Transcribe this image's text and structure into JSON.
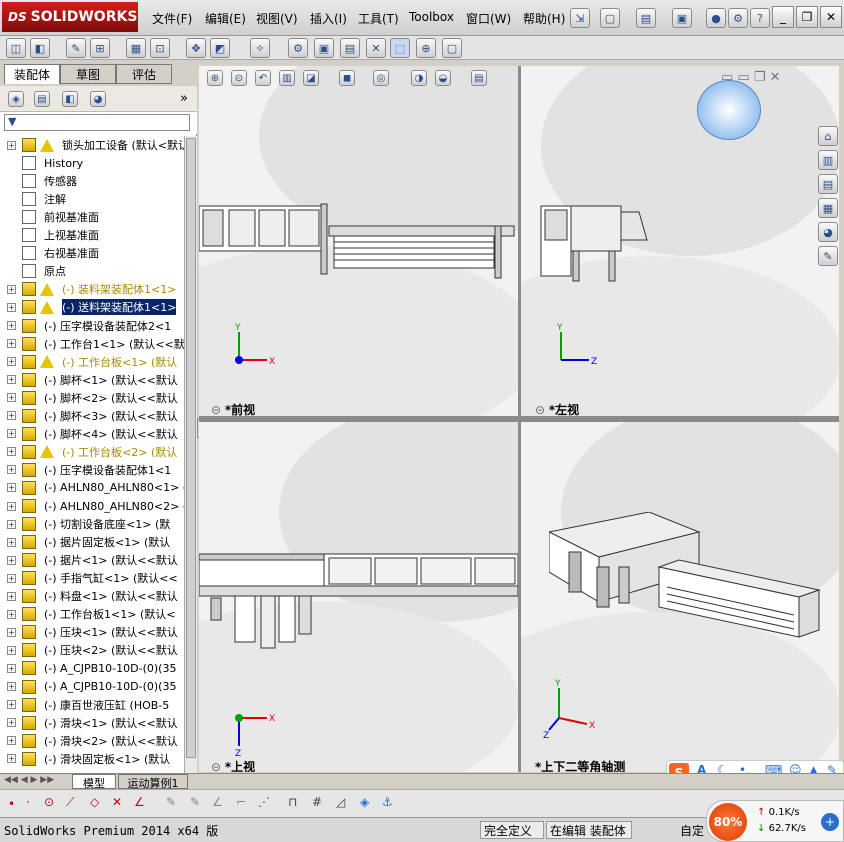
{
  "app": {
    "logo_text": "SOLIDWORKS",
    "logo_prefix": "DS"
  },
  "menu": [
    {
      "label": "文件(F)"
    },
    {
      "label": "编辑(E)"
    },
    {
      "label": "视图(V)"
    },
    {
      "label": "插入(I)"
    },
    {
      "label": "工具(T)"
    },
    {
      "label": "Toolbox"
    },
    {
      "label": "窗口(W)"
    },
    {
      "label": "帮助(H)"
    }
  ],
  "panel_tabs": [
    {
      "label": "装配体"
    },
    {
      "label": "草图"
    },
    {
      "label": "评估"
    }
  ],
  "tree": [
    {
      "label": "锁头加工设备 (默认<默认",
      "type": "root",
      "warn": true
    },
    {
      "label": "History",
      "type": "plain"
    },
    {
      "label": "传感器",
      "type": "plain"
    },
    {
      "label": "注解",
      "type": "plain"
    },
    {
      "label": "前视基准面",
      "type": "plain"
    },
    {
      "label": "上视基准面",
      "type": "plain"
    },
    {
      "label": "右视基准面",
      "type": "plain"
    },
    {
      "label": "原点",
      "type": "plain"
    },
    {
      "label": "(-) 装料架装配体1<1>",
      "type": "asm",
      "warn": true,
      "yellow": true
    },
    {
      "label": "(-) 送料架装配体1<1>",
      "type": "asm",
      "warn": true,
      "selected": true
    },
    {
      "label": "(-) 压字模设备装配体2<1",
      "type": "asm"
    },
    {
      "label": "(-) 工作台1<1> (默认<<默",
      "type": "part"
    },
    {
      "label": "(-) 工作台板<1> (默认",
      "type": "part",
      "warn": true,
      "yellow": true
    },
    {
      "label": "(-) 脚杯<1> (默认<<默认",
      "type": "part"
    },
    {
      "label": "(-) 脚杯<2> (默认<<默认",
      "type": "part"
    },
    {
      "label": "(-) 脚杯<3> (默认<<默认",
      "type": "part"
    },
    {
      "label": "(-) 脚杯<4> (默认<<默认",
      "type": "part"
    },
    {
      "label": "(-) 工作台板<2> (默认",
      "type": "part",
      "warn": true,
      "yellow": true
    },
    {
      "label": "(-) 压字模设备装配体1<1",
      "type": "asm"
    },
    {
      "label": "(-) AHLN80_AHLN80<1> (",
      "type": "part"
    },
    {
      "label": "(-) AHLN80_AHLN80<2> (",
      "type": "part"
    },
    {
      "label": "(-) 切割设备底座<1> (默",
      "type": "part"
    },
    {
      "label": "(-) 据片固定板<1> (默认",
      "type": "part"
    },
    {
      "label": "(-) 据片<1> (默认<<默认",
      "type": "part"
    },
    {
      "label": "(-) 手指气缸<1> (默认<<",
      "type": "part"
    },
    {
      "label": "(-) 料盘<1> (默认<<默认",
      "type": "part"
    },
    {
      "label": "(-) 工作台板1<1> (默认<",
      "type": "part"
    },
    {
      "label": "(-) 压块<1> (默认<<默认",
      "type": "part"
    },
    {
      "label": "(-) 压块<2> (默认<<默认",
      "type": "part"
    },
    {
      "label": "(-) A_CJPB10-10D-(0)(35",
      "type": "part"
    },
    {
      "label": "(-) A_CJPB10-10D-(0)(35",
      "type": "part"
    },
    {
      "label": "(-) 康百世液压缸 (HOB-5",
      "type": "part"
    },
    {
      "label": "(-) 滑块<1> (默认<<默认",
      "type": "part"
    },
    {
      "label": "(-) 滑块<2> (默认<<默认",
      "type": "part"
    },
    {
      "label": "(-) 滑块固定板<1> (默认",
      "type": "part"
    }
  ],
  "viewports": {
    "front": {
      "label": "*前视"
    },
    "left": {
      "label": "*左视"
    },
    "top": {
      "label": "*上视"
    },
    "iso": {
      "label": "*上下二等角轴测"
    }
  },
  "axes": {
    "x": "X",
    "y": "Y",
    "z": "Z"
  },
  "bottom_tabs": [
    {
      "label": "模型"
    },
    {
      "label": "运动算例1"
    }
  ],
  "status": {
    "app_version": "SolidWorks Premium 2014 x64 版",
    "defined": "完全定义",
    "editing": "在编辑 装配体",
    "custom": "自定"
  },
  "monitor": {
    "percent": "80%",
    "upload": "0.1K/s",
    "download": "62.7K/s"
  },
  "colors": {
    "selection": "#0a246a",
    "warning": "#e8c400",
    "axis_x": "#e00000",
    "axis_y": "#00a000",
    "axis_z": "#0000e0",
    "logo_red": "#c01a16"
  }
}
